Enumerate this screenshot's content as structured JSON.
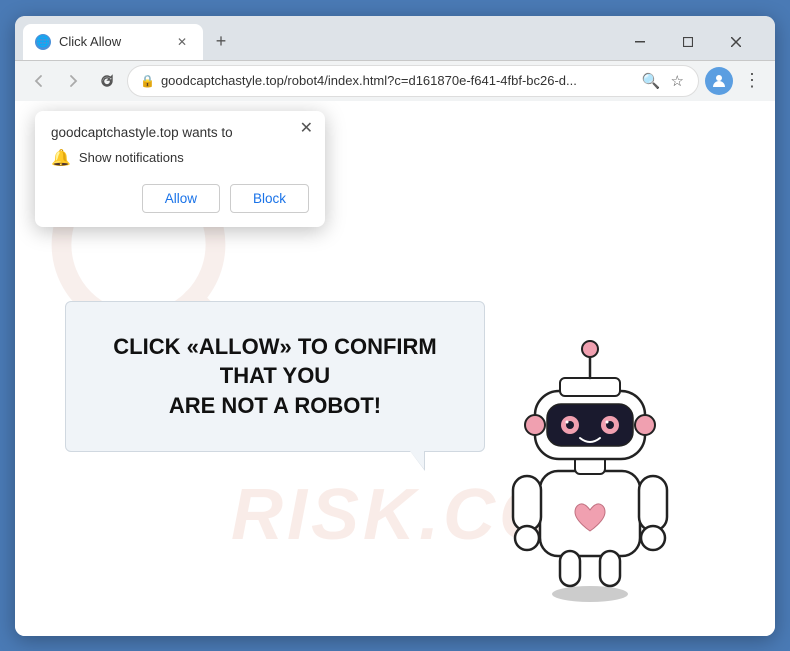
{
  "window": {
    "title": "Click Allow",
    "favicon": "🌐"
  },
  "tab": {
    "label": "Click Allow",
    "close_icon": "✕"
  },
  "new_tab_icon": "+",
  "nav": {
    "back_icon": "←",
    "forward_icon": "→",
    "refresh_icon": "↻",
    "address": "goodcaptchastyle.top/robot4/index.html?c=d161870e-f641-4fbf-bc26-d...",
    "lock_icon": "🔒",
    "search_icon": "🔍",
    "star_icon": "☆",
    "profile_icon": "👤",
    "menu_icon": "⋮"
  },
  "popup": {
    "title": "goodcaptchastyle.top wants to",
    "close_icon": "✕",
    "notification_label": "Show notifications",
    "allow_label": "Allow",
    "block_label": "Block"
  },
  "page": {
    "heading_line1": "CLICK «ALLOW» TO CONFIRM THAT YOU",
    "heading_line2": "ARE NOT A ROBOT!",
    "watermark": "RISK.CO"
  },
  "colors": {
    "accent_blue": "#1a73e8",
    "browser_bg": "#dee3e8",
    "popup_shadow": "rgba(0,0,0,0.25)"
  }
}
